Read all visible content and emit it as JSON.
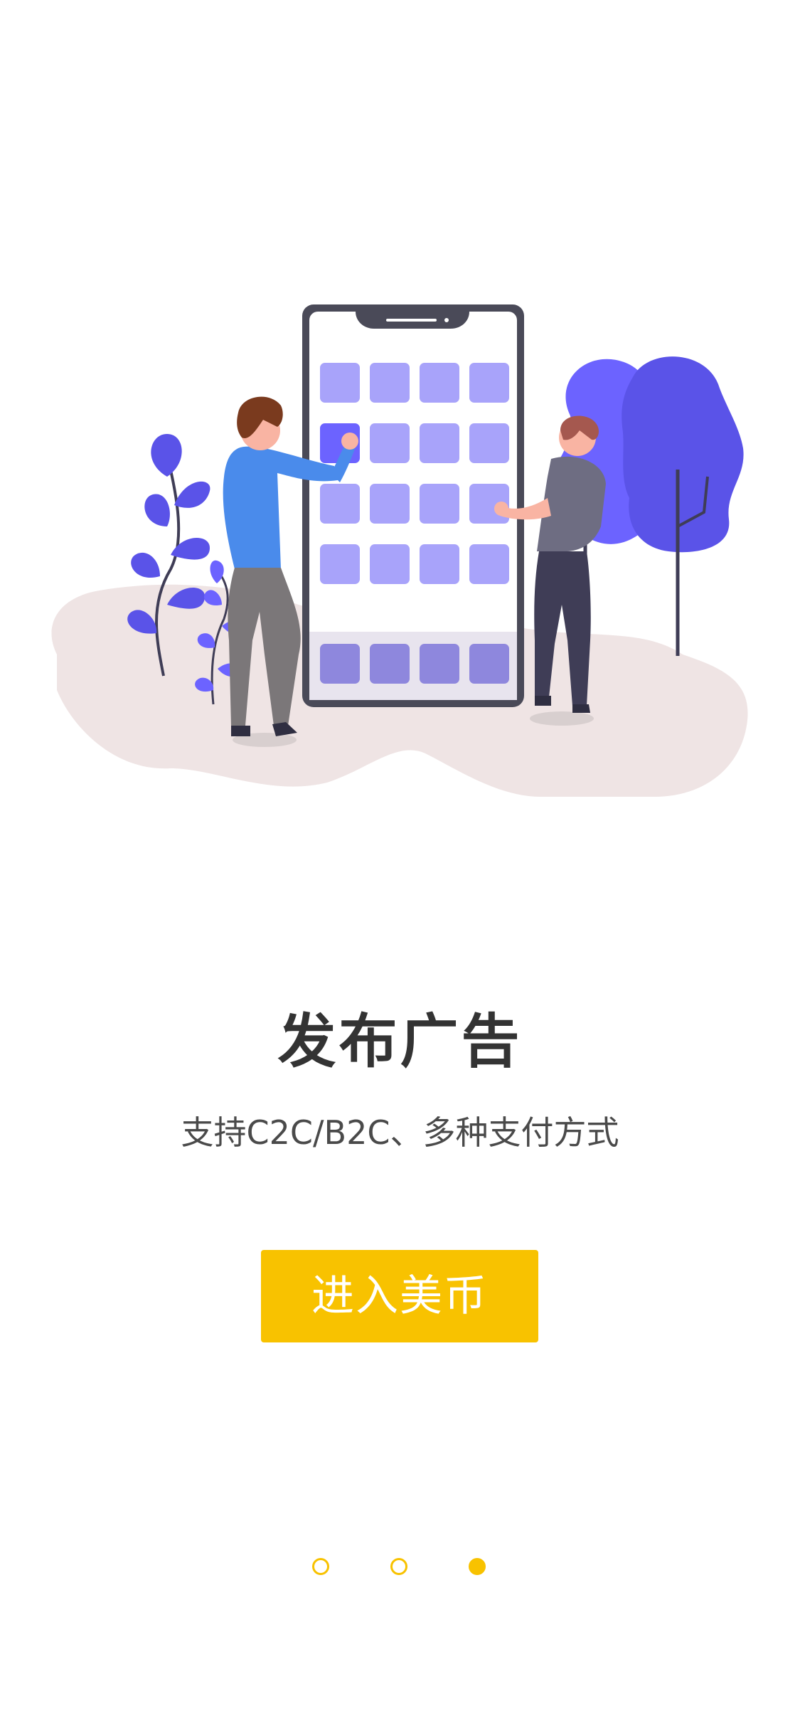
{
  "onboarding": {
    "title": "发布广告",
    "subtitle": "支持C2C/B2C、多种支付方式",
    "enter_button_label": "进入美币",
    "illustration_icon": "people-with-phone-illustration",
    "page_indicator": {
      "total": 3,
      "current": 3
    }
  },
  "colors": {
    "accent": "#F8C200",
    "title_text": "#333333",
    "subtitle_text": "#4a4a4a",
    "illustration_purple": "#6C63FF",
    "tile_light": "#A8A3FA",
    "ground": "#EFE4E4"
  }
}
